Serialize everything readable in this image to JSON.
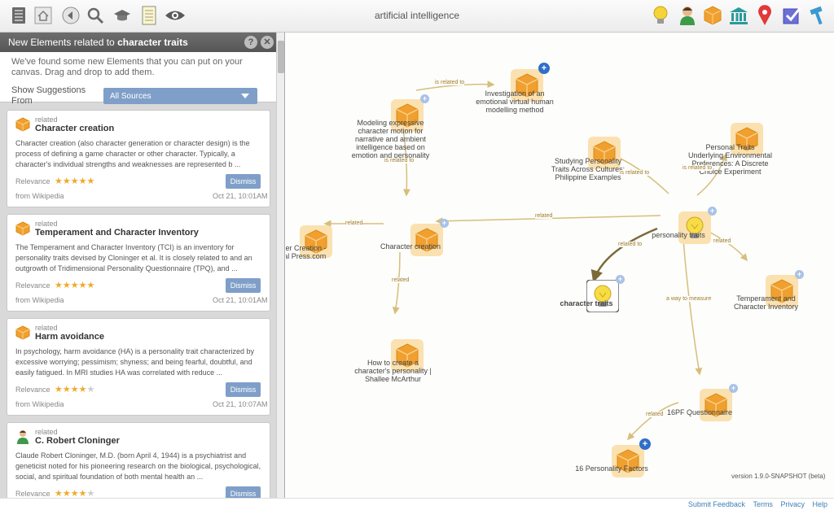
{
  "app": {
    "title": "artificial intelligence"
  },
  "toolbar": {
    "left_icons": [
      "list-icon",
      "home-icon",
      "back-icon",
      "search-icon",
      "graduation-cap-icon",
      "notes-icon",
      "eye-icon"
    ],
    "right_icons": [
      "lightbulb-icon",
      "person-icon",
      "cube-icon",
      "institution-icon",
      "location-pin-icon",
      "checkbox-icon",
      "hammer-icon"
    ]
  },
  "panel": {
    "header_prefix": "New Elements related to ",
    "header_topic": "character traits",
    "help_label": "?",
    "close_label": "✕",
    "intro": "We've found some new Elements that you can put on your canvas. Drag and drop to add them.",
    "suggestions_label": "Show Suggestions From",
    "suggestions_value": "All Sources"
  },
  "cards": [
    {
      "type": "related",
      "title": "Character creation",
      "icon": "cube-icon",
      "description": "Character creation (also character generation or character design) is the process of defining a game character or other character. Typically, a character's individual strengths and weaknesses are represented b ...",
      "relevance_label": "Relevance",
      "stars": 5,
      "dismiss_label": "Dismiss",
      "source": "from Wikipedia",
      "date": "Oct 21, 10:01AM"
    },
    {
      "type": "related",
      "title": "Temperament and Character Inventory",
      "icon": "cube-icon",
      "description": "The Temperament and Character Inventory (TCI) is an inventory for personality traits devised by Cloninger et al. It is closely related to and an outgrowth of Tridimensional Personality Questionnaire (TPQ), and ...",
      "relevance_label": "Relevance",
      "stars": 5,
      "dismiss_label": "Dismiss",
      "source": "from Wikipedia",
      "date": "Oct 21, 10:01AM"
    },
    {
      "type": "related",
      "title": "Harm avoidance",
      "icon": "cube-icon",
      "description": "In psychology, harm avoidance (HA) is a personality trait characterized by excessive worrying; pessimism; shyness; and being fearful, doubtful, and easily fatigued. In MRI studies HA was correlated with reduce ...",
      "relevance_label": "Relevance",
      "stars": 4,
      "dismiss_label": "Dismiss",
      "source": "from Wikipedia",
      "date": "Oct 21, 10:07AM"
    },
    {
      "type": "related",
      "title": "C. Robert Cloninger",
      "icon": "person-icon",
      "description": "Claude Robert Cloninger, M.D. (born April 4, 1944) is a psychiatrist and geneticist noted for his pioneering research on the biological, psychological, social, and spiritual foundation of both mental health an ...",
      "relevance_label": "Relevance",
      "stars": 4,
      "dismiss_label": "Dismiss",
      "source": "",
      "date": ""
    }
  ],
  "map": {
    "nodes": [
      {
        "id": "investigation",
        "label": "Investigation of an emotional virtual human modelling method",
        "icon": "cube-icon"
      },
      {
        "id": "modeling",
        "label": "Modeling expressive character motion for narrative and ambient intelligence based on emotion and personality",
        "icon": "cube-icon"
      },
      {
        "id": "studying",
        "label": "Studying Personality Traits Across Cultures: Philippine Examples",
        "icon": "cube-icon"
      },
      {
        "id": "personal-traits",
        "label": "Personal Traits Underlying Environmental Preferences: A Discrete Choice Experiment",
        "icon": "cube-icon"
      },
      {
        "id": "character-creation-press",
        "label": "cter Creation - Tal Press.com",
        "icon": "cube-icon"
      },
      {
        "id": "character-creation",
        "label": "Character creation",
        "icon": "cube-icon"
      },
      {
        "id": "personality-traits",
        "label": "personality traits",
        "icon": "lightbulb-icon"
      },
      {
        "id": "character-traits",
        "label": "character traits",
        "icon": "lightbulb-icon"
      },
      {
        "id": "temperament",
        "label": "Temperament and Character Inventory",
        "icon": "cube-icon"
      },
      {
        "id": "how-to-create",
        "label": "How to create a character's personality | Shallee McArthur",
        "icon": "cube-icon"
      },
      {
        "id": "16pf",
        "label": "16PF Questionnaire",
        "icon": "cube-icon"
      },
      {
        "id": "16factors",
        "label": "16 Personality Factors",
        "icon": "cube-icon"
      }
    ],
    "edges": [
      {
        "label": "is related to"
      },
      {
        "label": "is related to"
      },
      {
        "label": "related"
      },
      {
        "label": "related"
      },
      {
        "label": "related"
      },
      {
        "label": "is related to"
      },
      {
        "label": "is related to"
      },
      {
        "label": "related to"
      },
      {
        "label": "related"
      },
      {
        "label": "a way to measure"
      },
      {
        "label": "related"
      }
    ],
    "add_label": "+"
  },
  "version": "version 1.9.0-SNAPSHOT (beta)",
  "footer": {
    "links": [
      "Submit Feedback",
      "Terms",
      "Privacy",
      "Help"
    ]
  },
  "colors": {
    "accent_blue": "#7f9fc9",
    "cube_orange": "#f0a030",
    "edge": "#d6be7c",
    "star": "#f0a92a"
  }
}
